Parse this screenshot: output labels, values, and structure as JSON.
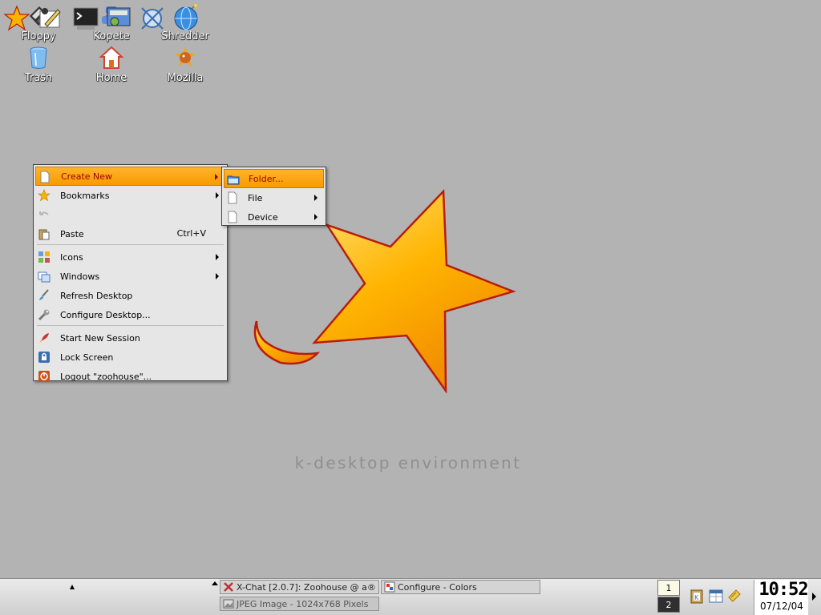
{
  "desktop": {
    "icons": [
      {
        "label": "Floppy",
        "icon": "floppy-icon"
      },
      {
        "label": "Kopete",
        "icon": "kopete-icon"
      },
      {
        "label": "Shredder",
        "icon": "shredder-bomb-icon"
      },
      {
        "label": "Trash",
        "icon": "trash-icon"
      },
      {
        "label": "Home",
        "icon": "home-icon"
      },
      {
        "label": "Mozilla",
        "icon": "mozilla-icon"
      }
    ],
    "tagline": "k-desktop environment",
    "wallpaper_colors": {
      "star_fill": "#f9a300",
      "star_edge": "#b71c0c",
      "background": "#b3b3b3"
    }
  },
  "context_menu": {
    "items": [
      {
        "label": "Create New",
        "icon": "document-icon",
        "submenu": true,
        "active": true
      },
      {
        "label": "Bookmarks",
        "icon": "star-icon",
        "submenu": true
      },
      {
        "label": "",
        "icon": "undo-icon",
        "disabled": true
      },
      {
        "label": "Paste",
        "icon": "paste-icon",
        "shortcut": "Ctrl+V"
      },
      {
        "label": "Icons",
        "icon": "icons-icon",
        "submenu": true
      },
      {
        "label": "Windows",
        "icon": "windows-icon",
        "submenu": true
      },
      {
        "label": "Refresh Desktop",
        "icon": "refresh-brush-icon"
      },
      {
        "label": "Configure Desktop...",
        "icon": "wrench-icon"
      },
      {
        "label": "Start New Session",
        "icon": "rocket-icon"
      },
      {
        "label": "Lock Screen",
        "icon": "lock-icon"
      },
      {
        "label": "Logout \"zoohouse\"...",
        "icon": "logout-icon"
      }
    ],
    "highlight_color": "#f89a00"
  },
  "create_new_submenu": {
    "items": [
      {
        "label": "Folder...",
        "icon": "folder-icon",
        "active": true
      },
      {
        "label": "File",
        "icon": "file-icon",
        "submenu": true
      },
      {
        "label": "Device",
        "icon": "device-icon",
        "submenu": true
      }
    ]
  },
  "panel": {
    "quick_launch": [
      "kde-menu-star-icon",
      "kwrite-editor-icon",
      "konsole-terminal-icon",
      "kcontrol-icon",
      "kmail-network-icon",
      "mozilla-globe-icon"
    ],
    "tasks": [
      {
        "label": "X-Chat [2.0.7]: Zoohouse @ a®",
        "icon": "xchat-icon"
      },
      {
        "label": "Configure - Colors",
        "icon": "colors-icon"
      },
      {
        "label": "JPEG Image - 1024x768 Pixels",
        "icon": "image-icon"
      }
    ],
    "pager": [
      "1",
      "2"
    ],
    "tray": [
      "klipper-icon",
      "korganizer-icon",
      "notes-icon"
    ],
    "clock": {
      "time": "10:52",
      "date": "07/12/04"
    }
  }
}
